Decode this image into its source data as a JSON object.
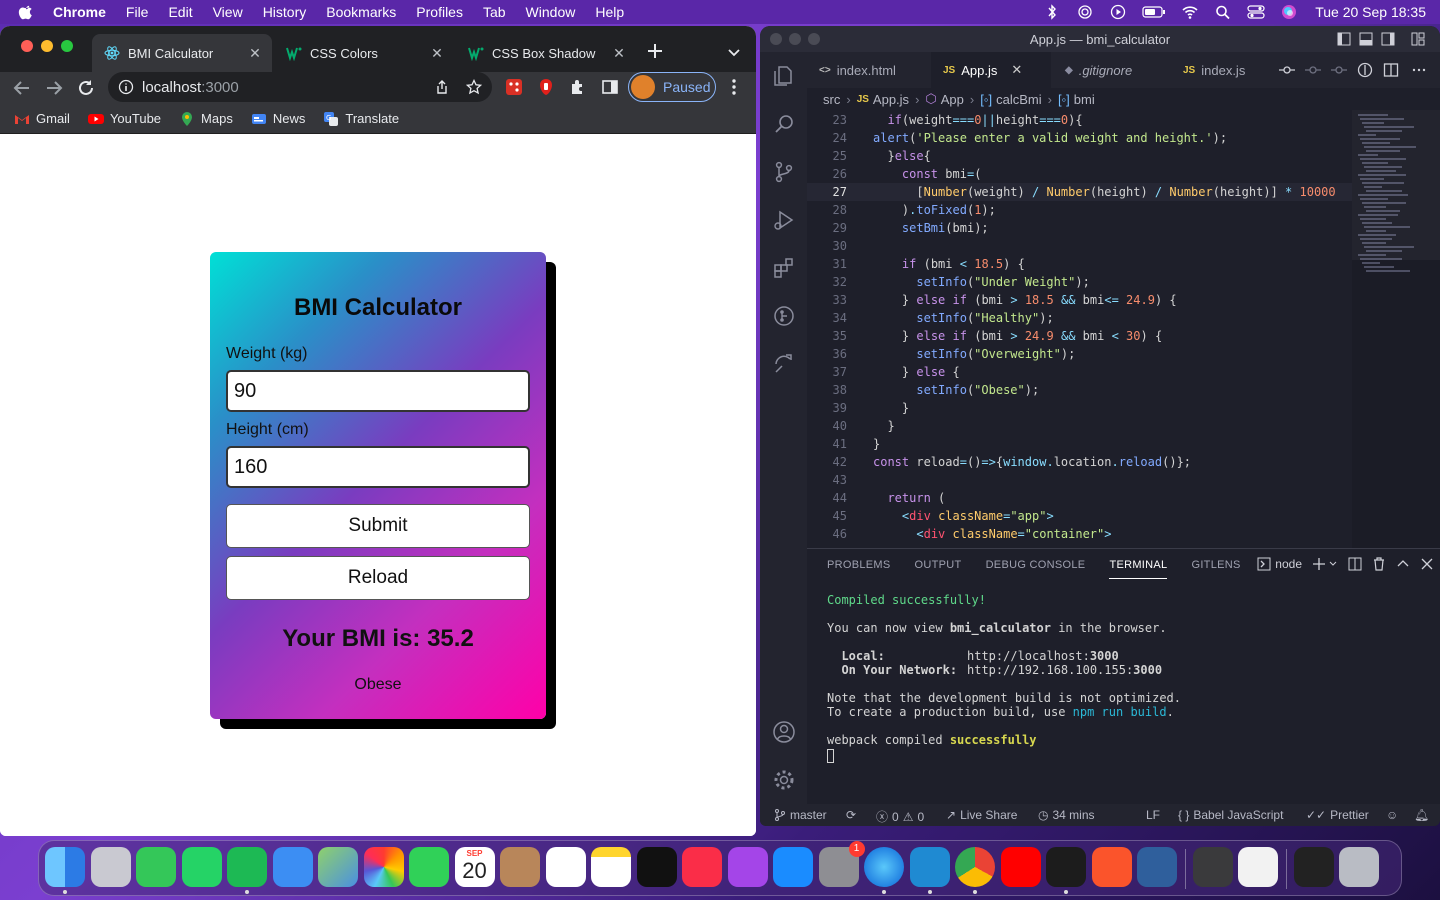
{
  "menubar": {
    "app_name": "Chrome",
    "items": [
      "File",
      "Edit",
      "View",
      "History",
      "Bookmarks",
      "Profiles",
      "Tab",
      "Window",
      "Help"
    ],
    "clock": "Tue 20 Sep  18:35"
  },
  "chrome": {
    "tabs": [
      {
        "title": "BMI Calculator",
        "active": true
      },
      {
        "title": "CSS Colors",
        "active": false
      },
      {
        "title": "CSS Box Shadow",
        "active": false
      }
    ],
    "url_host": "localhost",
    "url_port": ":3000",
    "profile_label": "Paused",
    "bookmarks": [
      "Gmail",
      "YouTube",
      "Maps",
      "News",
      "Translate"
    ]
  },
  "bmi_app": {
    "title": "BMI Calculator",
    "weight_label": "Weight (kg)",
    "weight_value": "90",
    "height_label": "Height (cm)",
    "height_value": "160",
    "submit_label": "Submit",
    "reload_label": "Reload",
    "result_text": "Your BMI is: 35.2",
    "info_text": "Obese"
  },
  "vscode": {
    "window_title": "App.js — bmi_calculator",
    "tabs": [
      {
        "icon": "<>",
        "title": "index.html"
      },
      {
        "icon": "JS",
        "title": "App.js",
        "active": true
      },
      {
        "icon": "◆",
        "title": ".gitignore"
      },
      {
        "icon": "JS",
        "title": "index.js"
      }
    ],
    "breadcrumb": [
      "src",
      "App.js",
      "App",
      "calcBmi",
      "bmi"
    ],
    "code_lines": [
      {
        "n": "23",
        "text": "  if(weight===0||height===0){"
      },
      {
        "n": "24",
        "text": "alert('Please enter a valid weight and height.');"
      },
      {
        "n": "25",
        "text": "  }else{"
      },
      {
        "n": "26",
        "text": "    const bmi=("
      },
      {
        "n": "27",
        "text": "      [Number(weight) / Number(height) / Number(height)] * 10000"
      },
      {
        "n": "28",
        "text": "    ).toFixed(1);"
      },
      {
        "n": "29",
        "text": "    setBmi(bmi);"
      },
      {
        "n": "30",
        "text": ""
      },
      {
        "n": "31",
        "text": "    if (bmi < 18.5) {"
      },
      {
        "n": "32",
        "text": "      setInfo(\"Under Weight\");"
      },
      {
        "n": "33",
        "text": "    } else if (bmi > 18.5 && bmi<= 24.9) {"
      },
      {
        "n": "34",
        "text": "      setInfo(\"Healthy\");"
      },
      {
        "n": "35",
        "text": "    } else if (bmi > 24.9 && bmi < 30) {"
      },
      {
        "n": "36",
        "text": "      setInfo(\"Overweight\");"
      },
      {
        "n": "37",
        "text": "    } else {"
      },
      {
        "n": "38",
        "text": "      setInfo(\"Obese\");"
      },
      {
        "n": "39",
        "text": "    }"
      },
      {
        "n": "40",
        "text": "  }"
      },
      {
        "n": "41",
        "text": "}"
      },
      {
        "n": "42",
        "text": "const reload=()=>{window.location.reload()};"
      },
      {
        "n": "43",
        "text": ""
      },
      {
        "n": "44",
        "text": "  return ("
      },
      {
        "n": "45",
        "text": "    <div className=\"app\">"
      },
      {
        "n": "46",
        "text": "      <div className=\"container\">"
      }
    ],
    "current_line": "27",
    "panel_tabs": [
      "PROBLEMS",
      "OUTPUT",
      "DEBUG CONSOLE",
      "TERMINAL",
      "GITLENS"
    ],
    "active_panel": "TERMINAL",
    "terminal_name": "node",
    "terminal": {
      "compiled": "Compiled successfully!",
      "view_pre": "You can now view ",
      "view_app": "bmi_calculator",
      "view_post": " in the browser.",
      "local_label": "  Local:",
      "local_url_pre": "http://localhost:",
      "local_url_port": "3000",
      "network_label": "  On Your Network:",
      "network_url_pre": "http://192.168.100.155:",
      "network_url_port": "3000",
      "note1": "Note that the development build is not optimized.",
      "note2_pre": "To create a production build, use ",
      "note2_cmd": "npm run build",
      "note2_post": ".",
      "webpack_pre": "webpack compiled ",
      "webpack_ok": "successfully"
    },
    "status": {
      "branch": "master",
      "errors": "0",
      "warnings": "0",
      "live_share": "Live Share",
      "time": "34 mins",
      "eol": "LF",
      "language": "Babel JavaScript",
      "formatter": "Prettier"
    }
  },
  "dock": {
    "calendar_month": "SEP",
    "calendar_day": "20",
    "settings_badge": "1",
    "apps": [
      "Finder",
      "Launchpad",
      "Messages",
      "WhatsApp",
      "Spotify",
      "Mail",
      "Maps",
      "Photos",
      "FaceTime",
      "Calendar",
      "Contacts",
      "Reminders",
      "Notes",
      "TV",
      "Music",
      "Podcasts",
      "App Store",
      "System Preferences",
      "Safari",
      "Visual Studio Code",
      "Google Chrome",
      "YouTube",
      "Terminal",
      "Brave",
      "QuickTime",
      "Calculator",
      "Preview",
      "Screen",
      "Trash"
    ]
  }
}
